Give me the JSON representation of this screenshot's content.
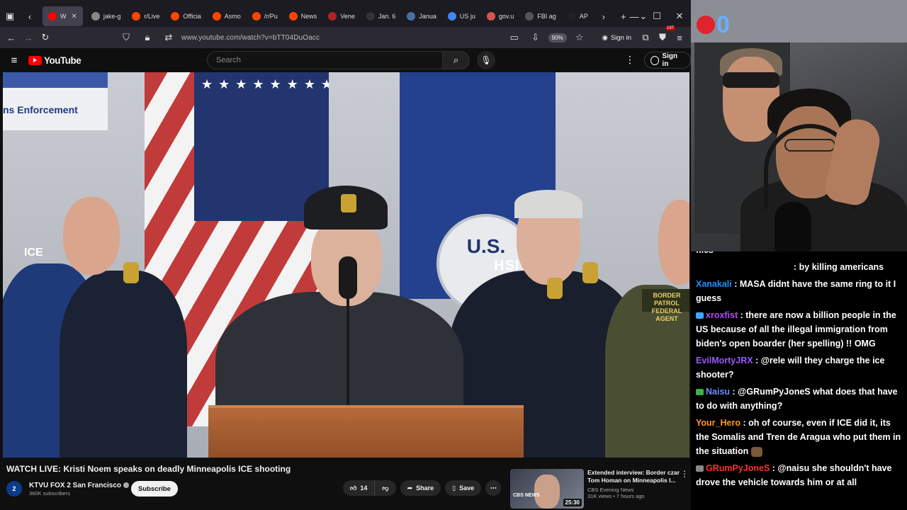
{
  "browser": {
    "tabs": [
      {
        "label": "W",
        "icon": "youtube-icon",
        "color": "#ff0000",
        "active": true
      },
      {
        "label": "jake-g",
        "icon": "blank-icon",
        "color": "#888888"
      },
      {
        "label": "r/Live",
        "icon": "reddit-icon",
        "color": "#ff4500"
      },
      {
        "label": "Officia",
        "icon": "reddit-icon",
        "color": "#ff4500"
      },
      {
        "label": "Asmo",
        "icon": "reddit-icon",
        "color": "#ff4500"
      },
      {
        "label": "/r/Pu",
        "icon": "reddit-icon",
        "color": "#ff4500"
      },
      {
        "label": "News",
        "icon": "reddit-icon",
        "color": "#ff4500"
      },
      {
        "label": "Vene",
        "icon": "globe-icon",
        "color": "#b22222"
      },
      {
        "label": "Jan. 6",
        "icon": "abc-icon",
        "color": "#333333"
      },
      {
        "label": "Janua",
        "icon": "bank-icon",
        "color": "#4a6fa5"
      },
      {
        "label": "US ju",
        "icon": "google-icon",
        "color": "#4285f4"
      },
      {
        "label": "gov.u",
        "icon": "warning-icon",
        "color": "#d9534f"
      },
      {
        "label": "FBI ag",
        "icon": "a-icon",
        "color": "#555555"
      },
      {
        "label": "AP",
        "icon": "ap-icon",
        "color": "#222222"
      }
    ],
    "url": "www.youtube.com/watch?v=bTT04DuOacc",
    "zoom": "90%",
    "sign_in": "Sign in",
    "extension_badge": "197"
  },
  "youtube": {
    "logo_text": "YouTube",
    "search_placeholder": "Search",
    "sign_in": "Sign in",
    "video": {
      "title": "WATCH LIVE: Kristi Noem speaks on deadly Minneapolis ICE shooting",
      "overlay_texts": {
        "sign": "ns Enforcement",
        "ice": "ICE",
        "hsi": "HSI",
        "patrol": "BORDER PATROL FEDERAL AGENT",
        "seal": "U.S."
      }
    },
    "channel": {
      "name": "KTVU FOX 2 San Francisco",
      "subscribers": "360K subscribers",
      "subscribe_label": "Subscribe"
    },
    "actions": {
      "likes": "14",
      "share": "Share",
      "save": "Save"
    },
    "recommended": {
      "title": "Extended interview: Border czar Tom Homan on Minneapolis I...",
      "channel": "CBS Evening News",
      "meta": "31K views • 7 hours ago",
      "duration": "25:30",
      "thumb_logo": "CBS NEWS"
    }
  },
  "stream": {
    "counter": "0",
    "chat": [
      {
        "user": "",
        "user_color": "#1f8fff",
        "text": "files",
        "partial": true
      },
      {
        "user": "",
        "user_color": "#ffffff",
        "text": ": by killing americans",
        "indent": true
      },
      {
        "user": "Xanakali",
        "user_color": "#1e90ff",
        "text": " : MASA didnt have the same ring to it I guess"
      },
      {
        "user": "xroxfist",
        "user_color": "#b44bff",
        "badge_color": "#3fa7ff",
        "text": " : there are now a billion people in the US because of all the illegal immigration from biden's open boarder (her spelling) !! OMG"
      },
      {
        "user": "EvilMortyJRX",
        "user_color": "#9b59ff",
        "text": " : @rele will they charge the ice shooter?"
      },
      {
        "user": "Naisu",
        "user_color": "#6b8bff",
        "badge_color": "#3cb043",
        "text": " : @GRumPyJoneS what does that have to do with anything?"
      },
      {
        "user": "Your_Hero",
        "user_color": "#ff9a1f",
        "text": " : oh of course, even if ICE did it, its the Somalis and Tren de Aragua who put them in the situation",
        "emote": true
      },
      {
        "user": "GRumPyJoneS",
        "user_color": "#ff3030",
        "badge_color": "#888888",
        "text": " : @naisu she shouldn't have drove the vehicle towards him or at all"
      }
    ]
  }
}
